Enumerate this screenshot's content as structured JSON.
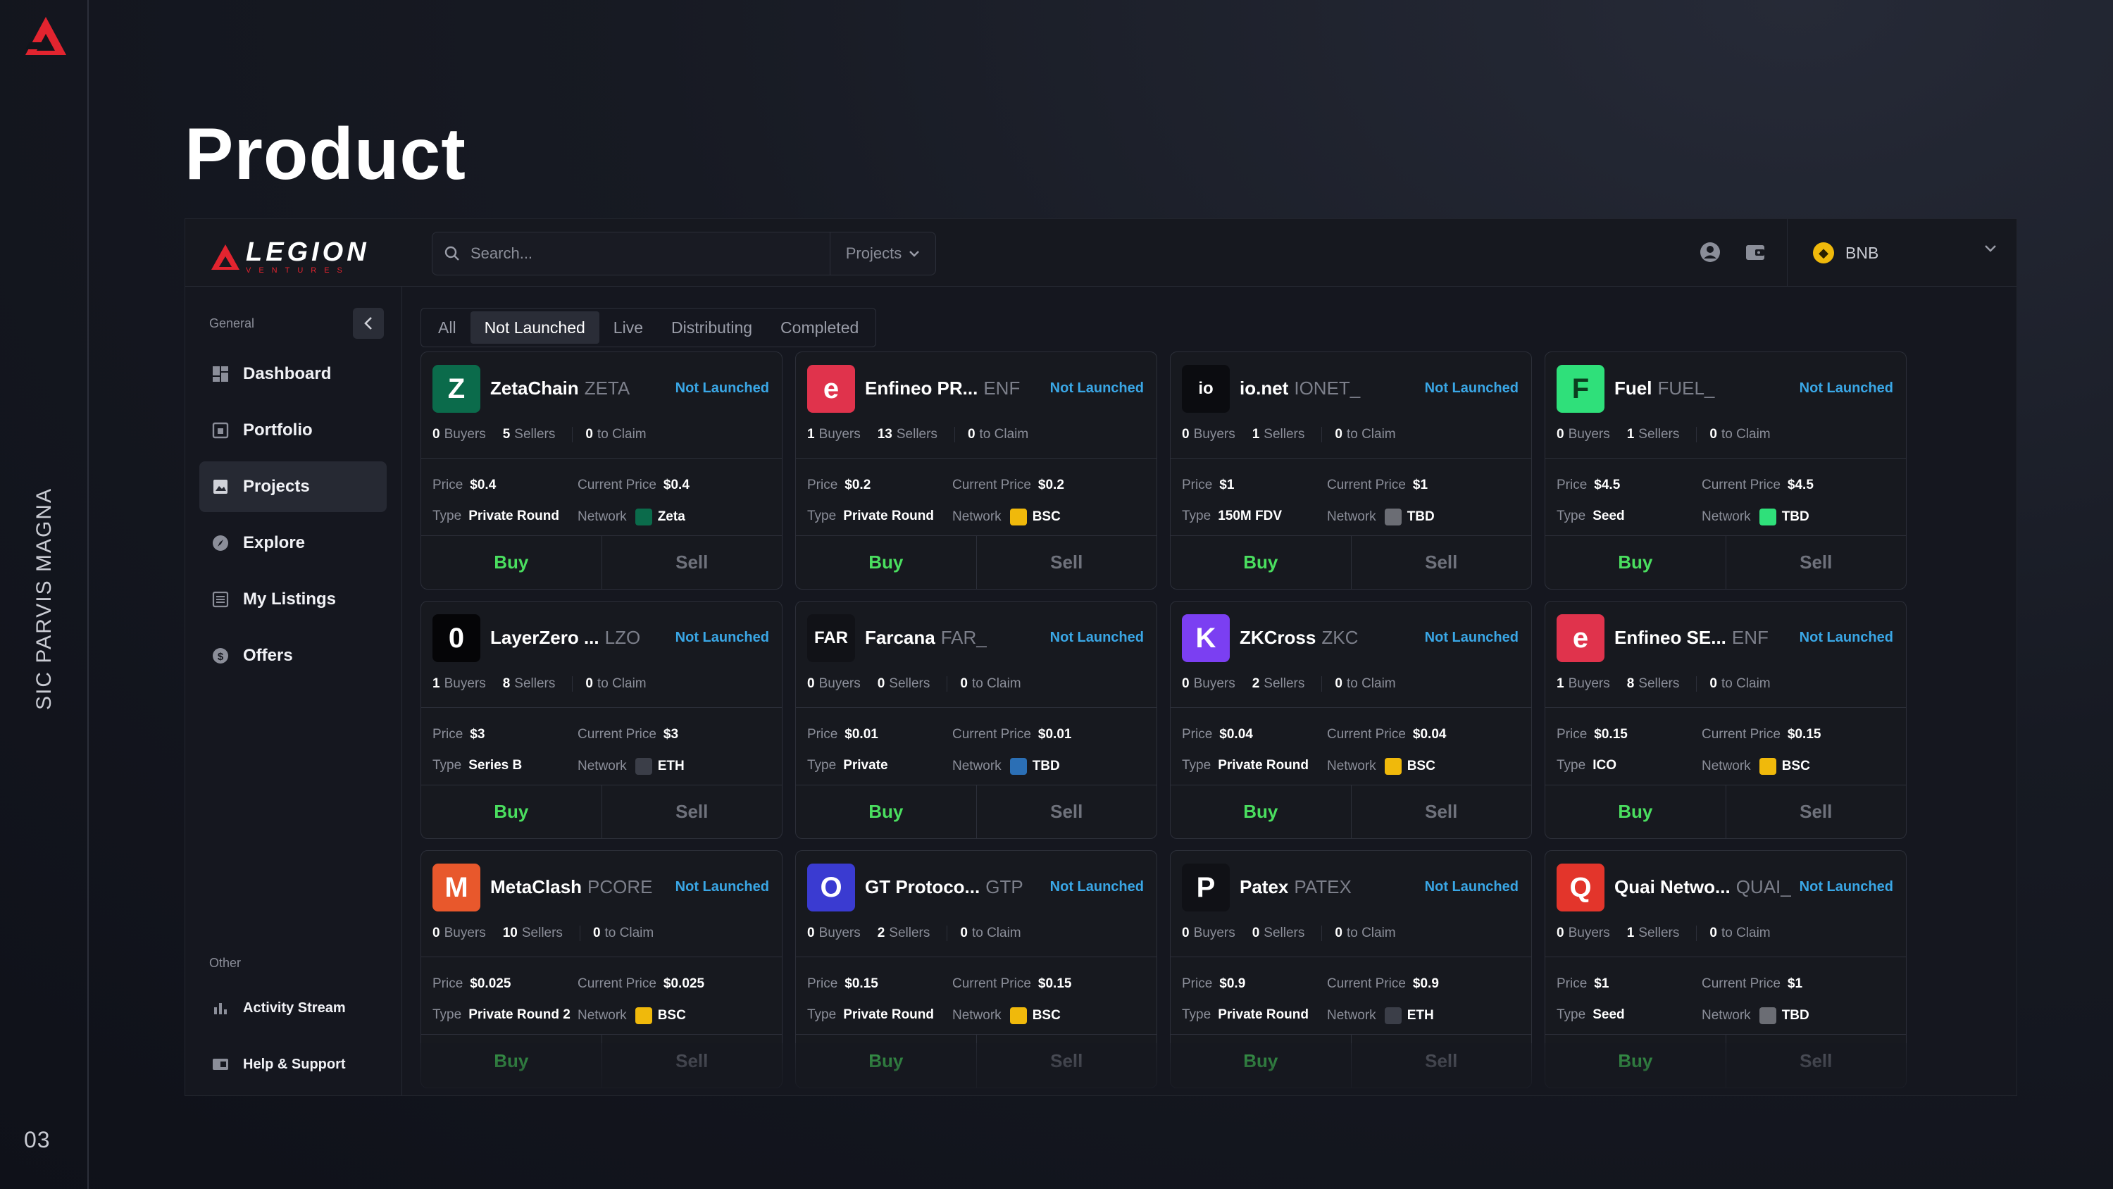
{
  "slide": {
    "title": "Product",
    "vertical_text": "SIC PARVIS MAGNA",
    "page_number": "03"
  },
  "brand": {
    "name": "LEGION",
    "sub": "VENTURES",
    "accent": "#e2242f"
  },
  "search": {
    "placeholder": "Search...",
    "scope": "Projects"
  },
  "chain": {
    "label": "BNB",
    "color": "#f0b90b"
  },
  "sidebar": {
    "general_label": "General",
    "other_label": "Other",
    "items": [
      {
        "label": "Dashboard",
        "icon": "dashboard-icon"
      },
      {
        "label": "Portfolio",
        "icon": "portfolio-icon"
      },
      {
        "label": "Projects",
        "icon": "projects-icon",
        "active": true
      },
      {
        "label": "Explore",
        "icon": "explore-icon"
      },
      {
        "label": "My Listings",
        "icon": "listings-icon"
      },
      {
        "label": "Offers",
        "icon": "offers-icon"
      }
    ],
    "other_items": [
      {
        "label": "Activity Stream",
        "icon": "activity-icon"
      },
      {
        "label": "Help & Support",
        "icon": "help-icon"
      }
    ]
  },
  "tabs": [
    {
      "label": "All"
    },
    {
      "label": "Not Launched",
      "active": true
    },
    {
      "label": "Live"
    },
    {
      "label": "Distributing"
    },
    {
      "label": "Completed"
    }
  ],
  "labels": {
    "buyers": "Buyers",
    "sellers": "Sellers",
    "to_claim": "to Claim",
    "price": "Price",
    "current_price": "Current Price",
    "type": "Type",
    "network": "Network",
    "buy": "Buy",
    "sell": "Sell"
  },
  "cards": [
    {
      "name": "ZetaChain",
      "ticker": "ZETA",
      "status": "Not Launched",
      "buyers": "0",
      "sellers": "5",
      "to_claim": "0",
      "price": "$0.4",
      "current_price": "$0.4",
      "type": "Private Round",
      "network": "Zeta",
      "logo_text": "Z",
      "logo_bg": "#0b6b4b",
      "net_color": "#0b6b4b"
    },
    {
      "name": "Enfineo PR...",
      "ticker": "ENF",
      "status": "Not Launched",
      "buyers": "1",
      "sellers": "13",
      "to_claim": "0",
      "price": "$0.2",
      "current_price": "$0.2",
      "type": "Private Round",
      "network": "BSC",
      "logo_text": "e",
      "logo_bg": "#e0334c",
      "net_color": "#f0b90b"
    },
    {
      "name": "io.net",
      "ticker": "IONET_",
      "status": "Not Launched",
      "buyers": "0",
      "sellers": "1",
      "to_claim": "0",
      "price": "$1",
      "current_price": "$1",
      "type": "150M FDV",
      "network": "TBD",
      "logo_text": "io",
      "logo_bg": "#0b0c10",
      "net_color": "#6b6d74"
    },
    {
      "name": "Fuel",
      "ticker": "FUEL_",
      "status": "Not Launched",
      "buyers": "0",
      "sellers": "1",
      "to_claim": "0",
      "price": "$4.5",
      "current_price": "$4.5",
      "type": "Seed",
      "network": "TBD",
      "logo_text": "F",
      "logo_bg": "#2fe07a",
      "net_color": "#2fe07a"
    },
    {
      "name": "LayerZero ...",
      "ticker": "LZO",
      "status": "Not Launched",
      "buyers": "1",
      "sellers": "8",
      "to_claim": "0",
      "price": "$3",
      "current_price": "$3",
      "type": "Series B",
      "network": "ETH",
      "logo_text": "0",
      "logo_bg": "#050507",
      "net_color": "#3b3e48"
    },
    {
      "name": "Farcana",
      "ticker": "FAR_",
      "status": "Not Launched",
      "buyers": "0",
      "sellers": "0",
      "to_claim": "0",
      "price": "$0.01",
      "current_price": "$0.01",
      "type": "Private",
      "network": "TBD",
      "logo_text": "FAR",
      "logo_bg": "#111217",
      "net_color": "#2b6fb5"
    },
    {
      "name": "ZKCross",
      "ticker": "ZKC",
      "status": "Not Launched",
      "buyers": "0",
      "sellers": "2",
      "to_claim": "0",
      "price": "$0.04",
      "current_price": "$0.04",
      "type": "Private Round",
      "network": "BSC",
      "logo_text": "K",
      "logo_bg": "#7b3ff2",
      "net_color": "#f0b90b"
    },
    {
      "name": "Enfineo SE...",
      "ticker": "ENF",
      "status": "Not Launched",
      "buyers": "1",
      "sellers": "8",
      "to_claim": "0",
      "price": "$0.15",
      "current_price": "$0.15",
      "type": "ICO",
      "network": "BSC",
      "logo_text": "e",
      "logo_bg": "#e0334c",
      "net_color": "#f0b90b"
    },
    {
      "name": "MetaClash",
      "ticker": "PCORE",
      "status": "Not Launched",
      "buyers": "0",
      "sellers": "10",
      "to_claim": "0",
      "price": "$0.025",
      "current_price": "$0.025",
      "type": "Private Round 2",
      "network": "BSC",
      "logo_text": "M",
      "logo_bg": "#e8582c",
      "net_color": "#f0b90b"
    },
    {
      "name": "GT Protoco...",
      "ticker": "GTP",
      "status": "Not Launched",
      "buyers": "0",
      "sellers": "2",
      "to_claim": "0",
      "price": "$0.15",
      "current_price": "$0.15",
      "type": "Private Round",
      "network": "BSC",
      "logo_text": "O",
      "logo_bg": "#3a3bd1",
      "net_color": "#f0b90b"
    },
    {
      "name": "Patex",
      "ticker": "PATEX",
      "status": "Not Launched",
      "buyers": "0",
      "sellers": "0",
      "to_claim": "0",
      "price": "$0.9",
      "current_price": "$0.9",
      "type": "Private Round",
      "network": "ETH",
      "logo_text": "P",
      "logo_bg": "#101116",
      "net_color": "#3b3e48"
    },
    {
      "name": "Quai Netwo...",
      "ticker": "QUAI_",
      "status": "Not Launched",
      "buyers": "0",
      "sellers": "1",
      "to_claim": "0",
      "price": "$1",
      "current_price": "$1",
      "type": "Seed",
      "network": "TBD",
      "logo_text": "Q",
      "logo_bg": "#e3352b",
      "net_color": "#6b6d74"
    }
  ]
}
